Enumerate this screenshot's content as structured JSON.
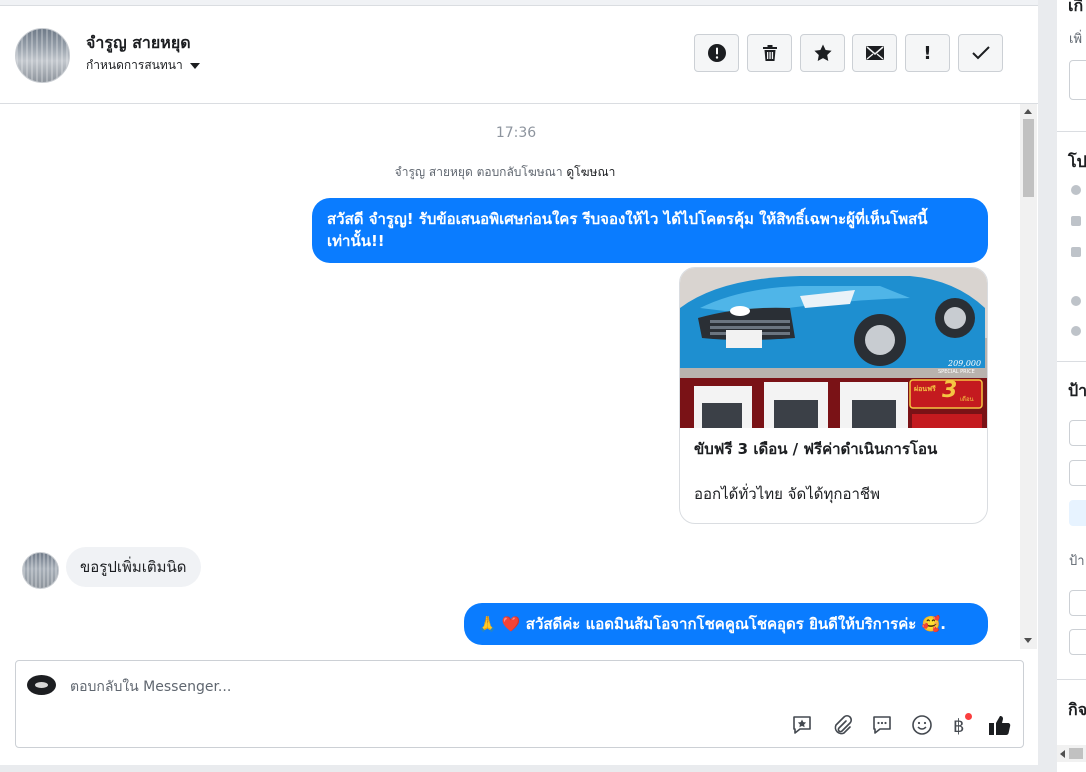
{
  "header": {
    "customer_name": "จำรูญ สายหยุด",
    "assign_label": "กำหนดการสนทนา",
    "actions": [
      {
        "name": "report",
        "label": "Report spam"
      },
      {
        "name": "delete",
        "label": "Delete"
      },
      {
        "name": "star",
        "label": "Star"
      },
      {
        "name": "mark-unread",
        "label": "Mark unread"
      },
      {
        "name": "follow-up",
        "label": "!"
      },
      {
        "name": "done",
        "label": "Done"
      }
    ]
  },
  "conversation": {
    "timestamp": "17:36",
    "ad_reply_text": "จำรูญ สายหยุด ตอบกลับโฆษณา",
    "ad_link": "ดูโฆษณา",
    "messages": [
      {
        "from": "page",
        "text": "สวัสดี จำรูญ! รับข้อเสนอพิเศษก่อนใคร รีบจองให้ไว ได้ไปโคตรคุ้ม ให้สิทธิ์เฉพาะผู้ที่เห็นโพสนี้เท่านั้น!!"
      },
      {
        "from": "page",
        "type": "card",
        "title": "ขับฟรี 3 เดือน / ฟรีค่าดำเนินการโอน",
        "subtitle": "ออกได้ทั่วไทย จัดได้ทุกอาชีพ",
        "image_price": "209,000",
        "image_price_note": "SPECIAL PRICE",
        "image_promo": "ผ่อนฟรี",
        "image_promo_number": "3",
        "image_promo_unit": "เดือน"
      },
      {
        "from": "customer",
        "text": "ขอรูปเพิ่มเติมนิด"
      },
      {
        "from": "page",
        "text": "🙏 ❤️ สวัสดีค่ะ แอดมินส้มโอจากโชคคูณโชคอุดร ยินดีให้บริการค่ะ 🥰."
      }
    ]
  },
  "composer": {
    "placeholder": "ตอบกลับใน Messenger...",
    "tools": [
      "saved-replies-icon",
      "attach-icon",
      "chat-icon",
      "emoji-icon",
      "baht-payment-icon",
      "like-icon"
    ]
  },
  "right_panel": {
    "labels": [
      "เกี",
      "เพิ่",
      "โป",
      "ป้า",
      "ป้า",
      "กิจ"
    ]
  },
  "colors": {
    "accent": "#0a7cff",
    "incoming_bubble": "#f0f2f5",
    "border": "#dadde1",
    "notification_dot": "#fa3e3e"
  }
}
